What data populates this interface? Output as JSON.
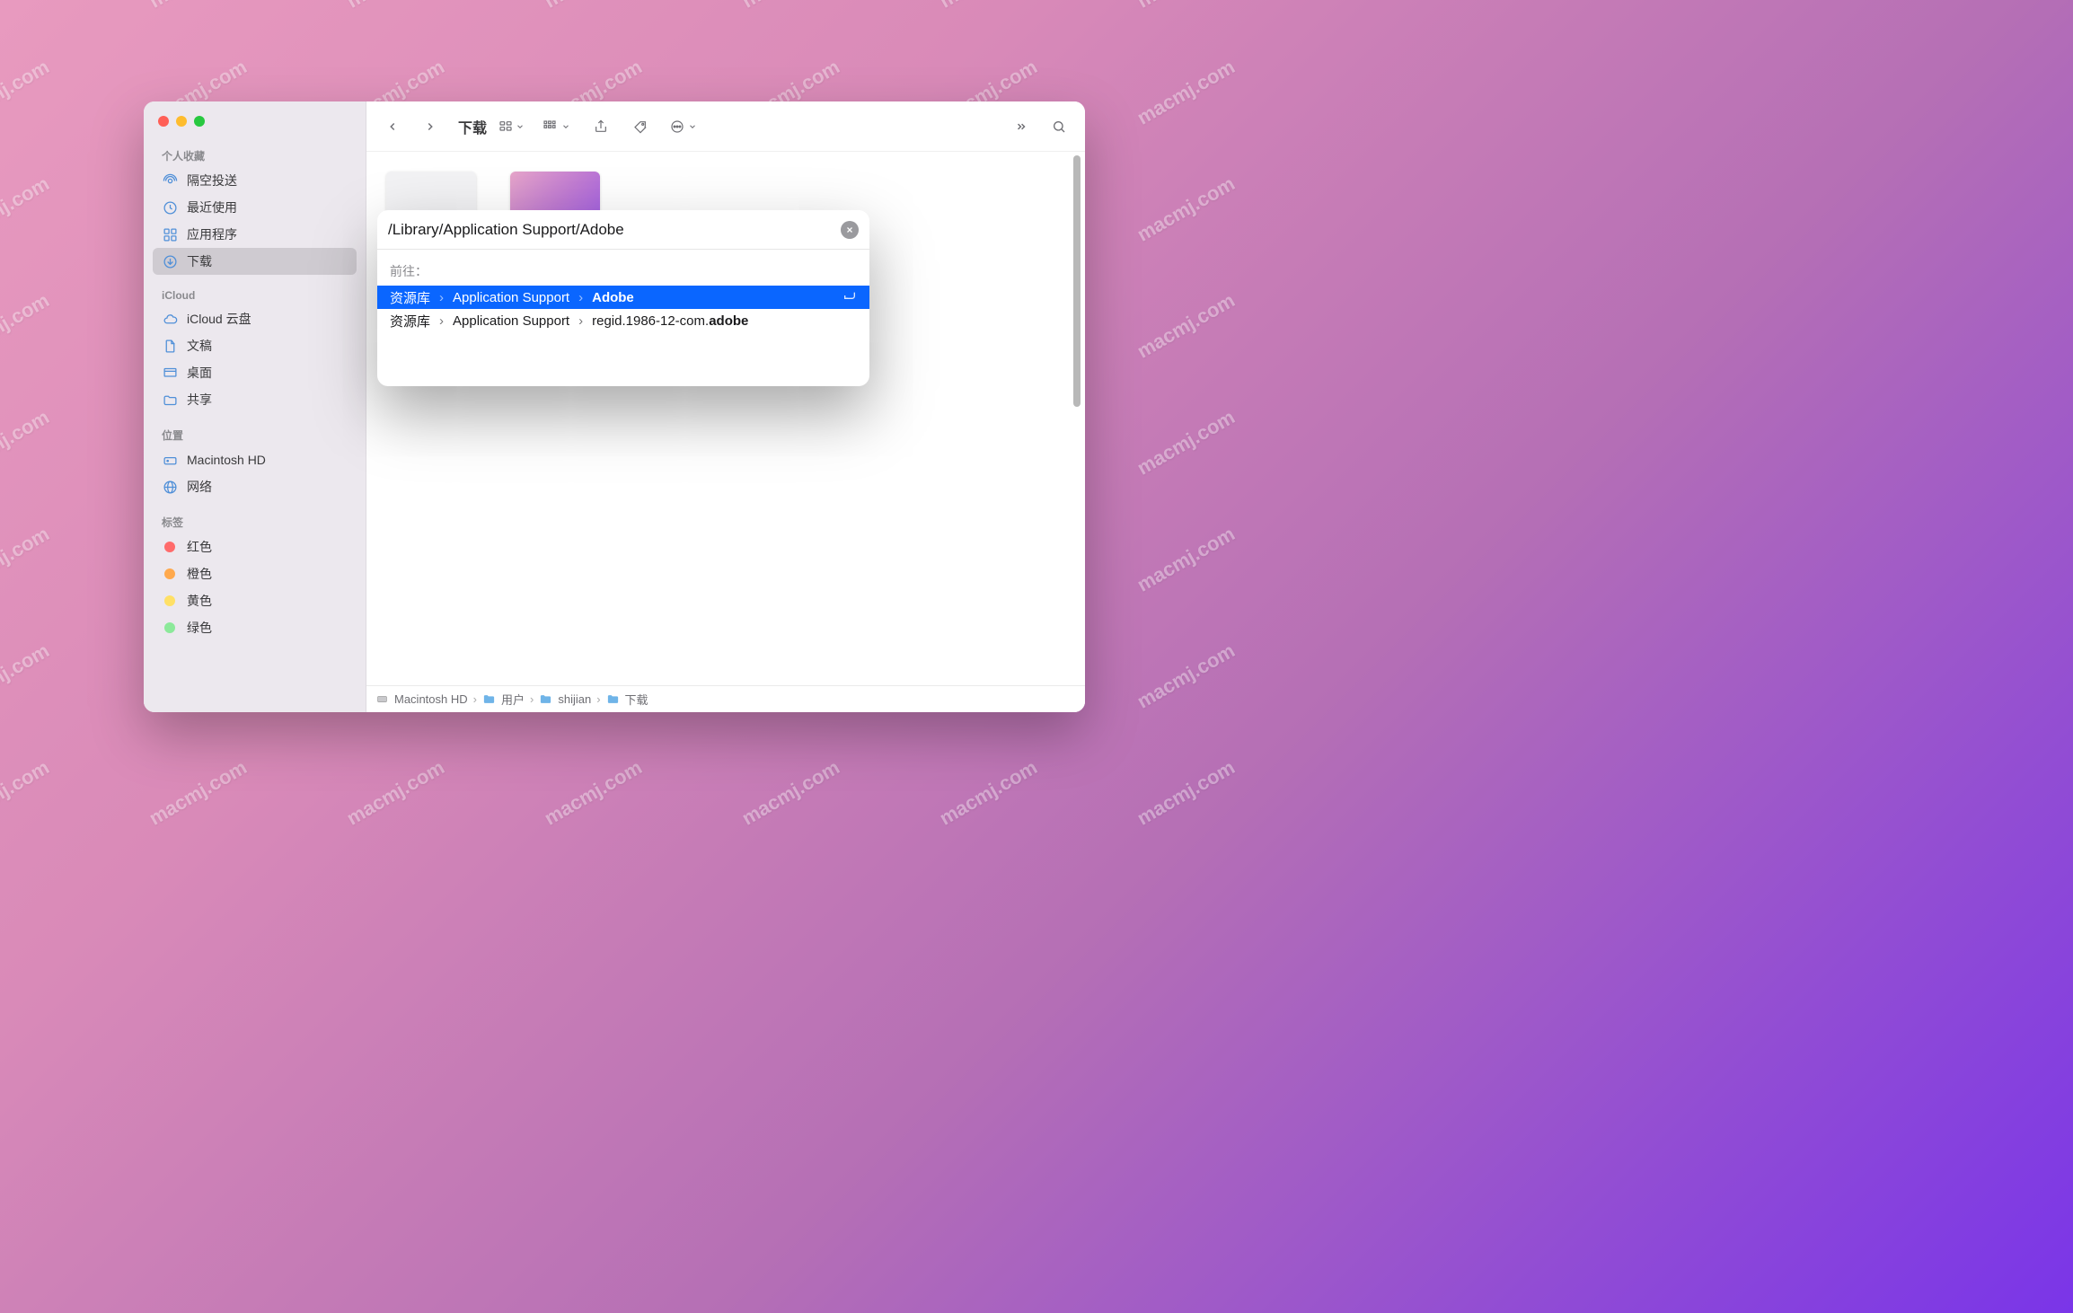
{
  "watermark_text": "macmj.com",
  "finder": {
    "title": "下载",
    "sidebar": {
      "sections": [
        {
          "label": "个人收藏",
          "items": [
            {
              "name": "隔空投送",
              "icon": "airdrop",
              "selected": false
            },
            {
              "name": "最近使用",
              "icon": "clock",
              "selected": false
            },
            {
              "name": "应用程序",
              "icon": "apps",
              "selected": false
            },
            {
              "name": "下载",
              "icon": "download",
              "selected": true
            }
          ]
        },
        {
          "label": "iCloud",
          "items": [
            {
              "name": "iCloud 云盘",
              "icon": "cloud"
            },
            {
              "name": "文稿",
              "icon": "doc"
            },
            {
              "name": "桌面",
              "icon": "desktop"
            },
            {
              "name": "共享",
              "icon": "shared"
            }
          ]
        },
        {
          "label": "位置",
          "items": [
            {
              "name": "Macintosh HD",
              "icon": "disk"
            },
            {
              "name": "网络",
              "icon": "globe"
            }
          ]
        },
        {
          "label": "标签",
          "items": [
            {
              "name": "红色",
              "tag": "red"
            },
            {
              "name": "橙色",
              "tag": "orange"
            },
            {
              "name": "黄色",
              "tag": "yellow"
            },
            {
              "name": "绿色",
              "tag": "green"
            }
          ]
        }
      ]
    },
    "pathbar": [
      "Macintosh HD",
      "用户",
      "shijian",
      "下载"
    ]
  },
  "goto": {
    "path": "/Library/Application Support/Adobe",
    "section_label": "前往：",
    "results": [
      {
        "segments": [
          "资源库",
          "Application Support"
        ],
        "last": "Adobe",
        "selected": true
      },
      {
        "segments": [
          "资源库",
          "Application Support"
        ],
        "last_prefix": "regid.1986-12-com.",
        "last_bold": "adobe",
        "selected": false
      }
    ]
  }
}
